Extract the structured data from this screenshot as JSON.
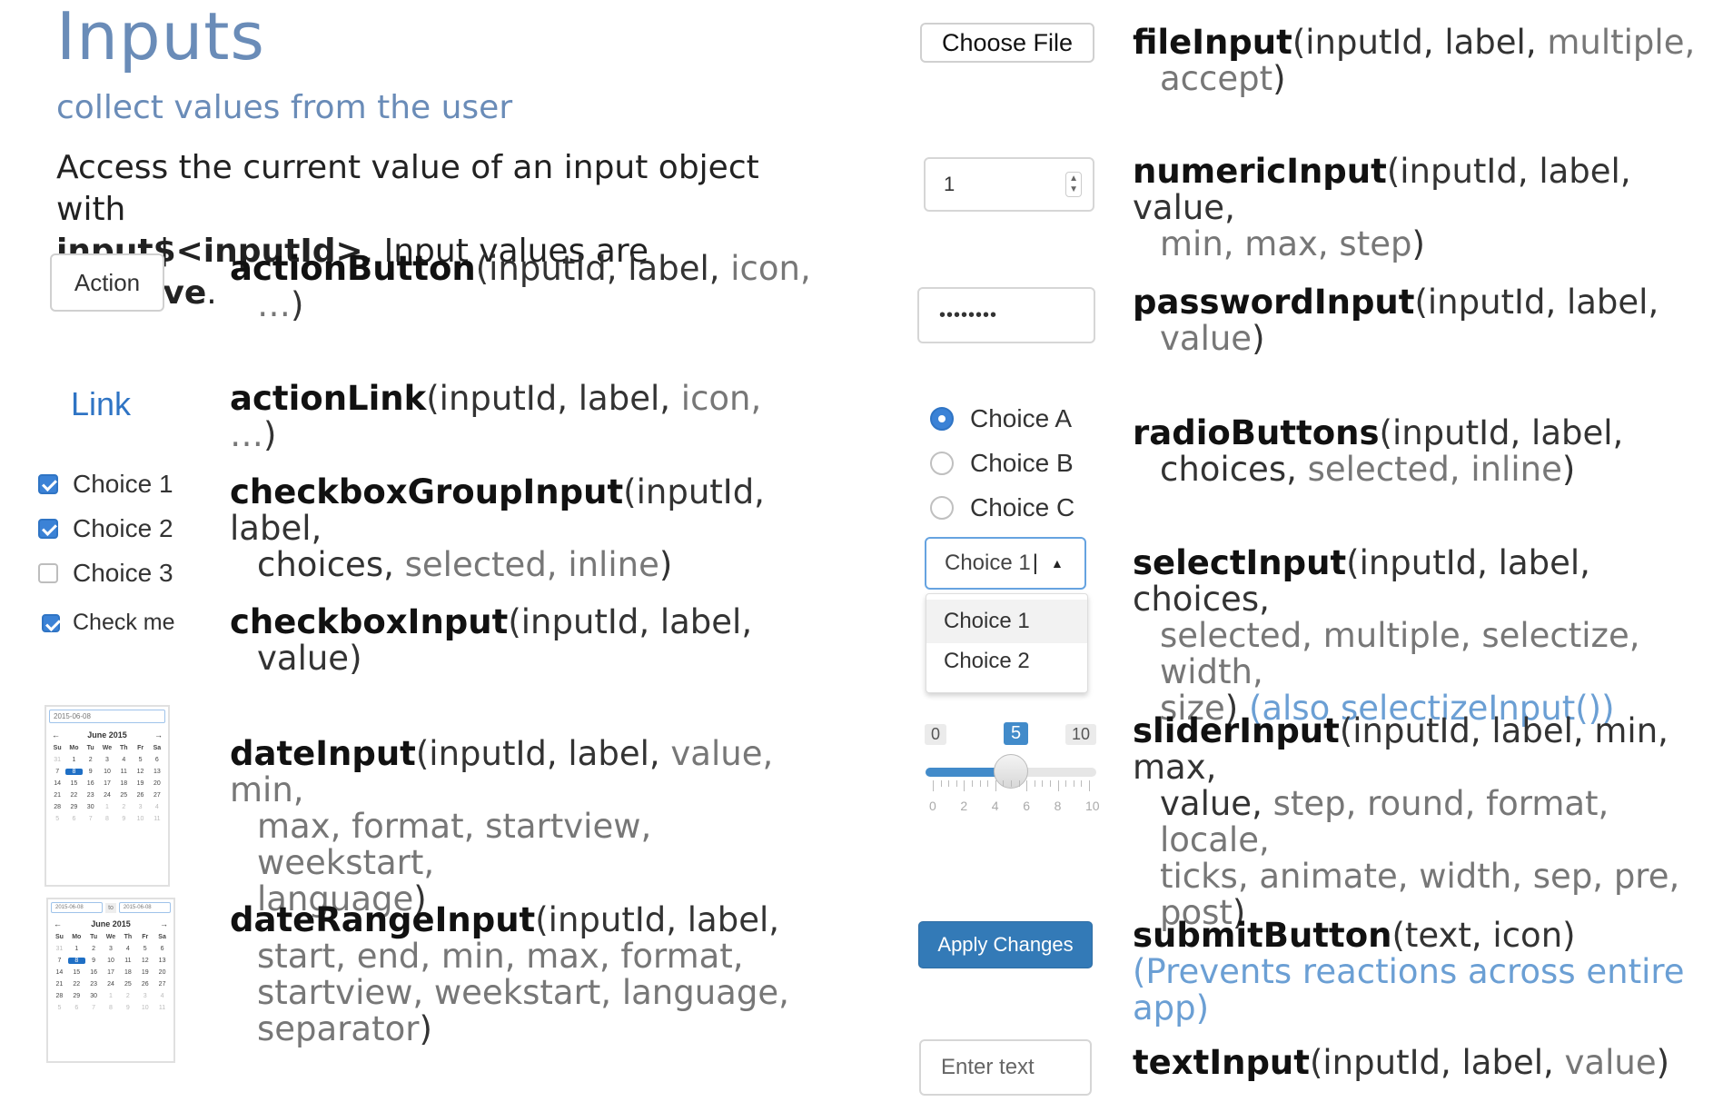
{
  "header": {
    "title": "Inputs",
    "subtitle": "collect values from the user",
    "intro_1": "Access the current value of an input object with",
    "intro_bold": "input$<inputId>",
    "intro_2": ". Input values are ",
    "intro_reactive": "reactive",
    "intro_3": "."
  },
  "colors": {
    "accent": "#6a8cb8",
    "link": "#2f74c4",
    "primary": "#337ab7",
    "note": "#6b9fd4"
  },
  "widgets": {
    "action_label": "Action",
    "link_label": "Link",
    "checkbox_group": [
      {
        "label": "Choice 1",
        "checked": true
      },
      {
        "label": "Choice 2",
        "checked": true
      },
      {
        "label": "Choice 3",
        "checked": false
      }
    ],
    "checkbox_label": "Check me",
    "date_value": "2015-06-08",
    "date_range_start": "2015-06-08",
    "date_range_to": "to",
    "date_range_end": "2015-06-08",
    "calendar_month": "June 2015",
    "calendar_prev": "←",
    "calendar_next": "→",
    "weekdays": [
      "Su",
      "Mo",
      "Tu",
      "We",
      "Th",
      "Fr",
      "Sa"
    ],
    "calendar_days": [
      "31",
      "1",
      "2",
      "3",
      "4",
      "5",
      "6",
      "7",
      "8",
      "9",
      "10",
      "11",
      "12",
      "13",
      "14",
      "15",
      "16",
      "17",
      "18",
      "19",
      "20",
      "21",
      "22",
      "23",
      "24",
      "25",
      "26",
      "27",
      "28",
      "29",
      "30",
      "1",
      "2",
      "3",
      "4",
      "5",
      "6",
      "7",
      "8",
      "9",
      "10",
      "11"
    ],
    "calendar_selected": "8",
    "file_label": "Choose File",
    "numeric_value": "1",
    "password_value": "••••••••",
    "radio_choices": [
      {
        "label": "Choice A",
        "selected": true
      },
      {
        "label": "Choice B",
        "selected": false
      },
      {
        "label": "Choice C",
        "selected": false
      }
    ],
    "select_value": "Choice 1",
    "select_options": [
      "Choice 1",
      "Choice 2"
    ],
    "slider": {
      "min": "0",
      "max": "10",
      "value": "5",
      "value_fraction": 0.5,
      "ticks": [
        "0",
        "2",
        "4",
        "6",
        "8",
        "10"
      ]
    },
    "submit_label": "Apply Changes",
    "text_placeholder": "Enter text"
  },
  "functions": {
    "actionButton": {
      "name": "actionButton",
      "args": "(inputId, label, ",
      "opt": "icon,",
      "cont_opt": "…",
      "close": ")"
    },
    "actionLink": {
      "name": "actionLink",
      "args": "(inputId, label, ",
      "opt": "icon, …",
      "close": ")"
    },
    "checkboxGroupInput": {
      "name": "checkboxGroupInput",
      "args": "(inputId, label,",
      "cont_req": "choices, ",
      "cont_opt": "selected, inline",
      "close": ")"
    },
    "checkboxInput": {
      "name": "checkboxInput",
      "args": "(inputId, label,",
      "cont_req": "value",
      "close": ")"
    },
    "dateInput": {
      "name": "dateInput",
      "args": "(inputId, label, ",
      "opt": "value, min,",
      "line2": "max, format, startview, weekstart,",
      "line3": "language",
      "close": ")"
    },
    "dateRangeInput": {
      "name": "dateRangeInput",
      "args": "(inputId, label,",
      "line2": "start, end, min, max, format,",
      "line3": "startview, weekstart, language,",
      "line4": "separator",
      "close": ")"
    },
    "fileInput": {
      "name": "fileInput",
      "args": "(inputId, label, ",
      "opt": "multiple,",
      "line2": "accept",
      "close": ")"
    },
    "numericInput": {
      "name": "numericInput",
      "args": "(inputId, label, value,",
      "line2": "min, max, step",
      "close": ")"
    },
    "passwordInput": {
      "name": "passwordInput",
      "args": "(inputId, label,",
      "line2": "value",
      "close": ")"
    },
    "radioButtons": {
      "name": "radioButtons",
      "args": "(inputId, label,",
      "cont_req": "choices, ",
      "cont_opt": "selected, inline",
      "close": ")"
    },
    "selectInput": {
      "name": "selectInput",
      "args": "(inputId, label, choices,",
      "line2": "selected, multiple, selectize, width,",
      "line3": "size",
      "close": ")",
      "note": " (also selectizeInput())"
    },
    "sliderInput": {
      "name": "sliderInput",
      "args": "(inputId, label, min, max,",
      "line2_req": "value, ",
      "line2_opt": "step, round, format, locale,",
      "line3": "ticks, animate, width, sep, pre,",
      "line4": "post",
      "close": ")"
    },
    "submitButton": {
      "name": "submitButton",
      "args": "(text, icon)",
      "note": "(Prevents reactions across entire app)"
    },
    "textInput": {
      "name": "textInput",
      "args": "(inputId, label, ",
      "opt": "value",
      "close": ")"
    }
  }
}
